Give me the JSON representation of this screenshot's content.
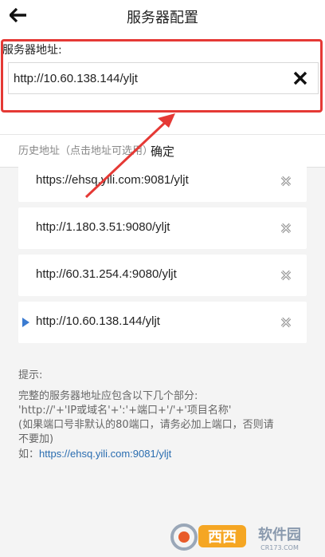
{
  "header": {
    "title": "服务器配置",
    "back_icon": "arrow-left-icon"
  },
  "server": {
    "label": "服务器地址:",
    "value": "http://10.60.138.144/yljt",
    "clear_icon": "close-icon"
  },
  "confirm_label": "确定",
  "history": {
    "label": "历史地址（点击地址可选用）:",
    "items": [
      {
        "url": "https://ehsq.yili.com:9081/yljt",
        "selected": false
      },
      {
        "url": "http://1.180.3.51:9080/yljt",
        "selected": false
      },
      {
        "url": "http://60.31.254.4:9080/yljt",
        "selected": false
      },
      {
        "url": "http://10.60.138.144/yljt",
        "selected": true
      }
    ]
  },
  "tips": {
    "title": "提示:",
    "line1": "完整的服务器地址应包含以下几个部分:",
    "line2": "'http://'+'IP或域名'+':'+端口+'/'+'项目名称'",
    "line3": "(如果端口号非默认的80端口，请务必加上端口，否则请",
    "line4": "不要加)",
    "example_prefix": "如：",
    "example_url": "https://ehsq.yili.com:9081/yljt"
  },
  "watermark": {
    "brand": "西西软件园",
    "site": "CR173.COM"
  },
  "colors": {
    "highlight": "#e53935",
    "link": "#2a6db0",
    "pointer": "#3b7bd1"
  }
}
